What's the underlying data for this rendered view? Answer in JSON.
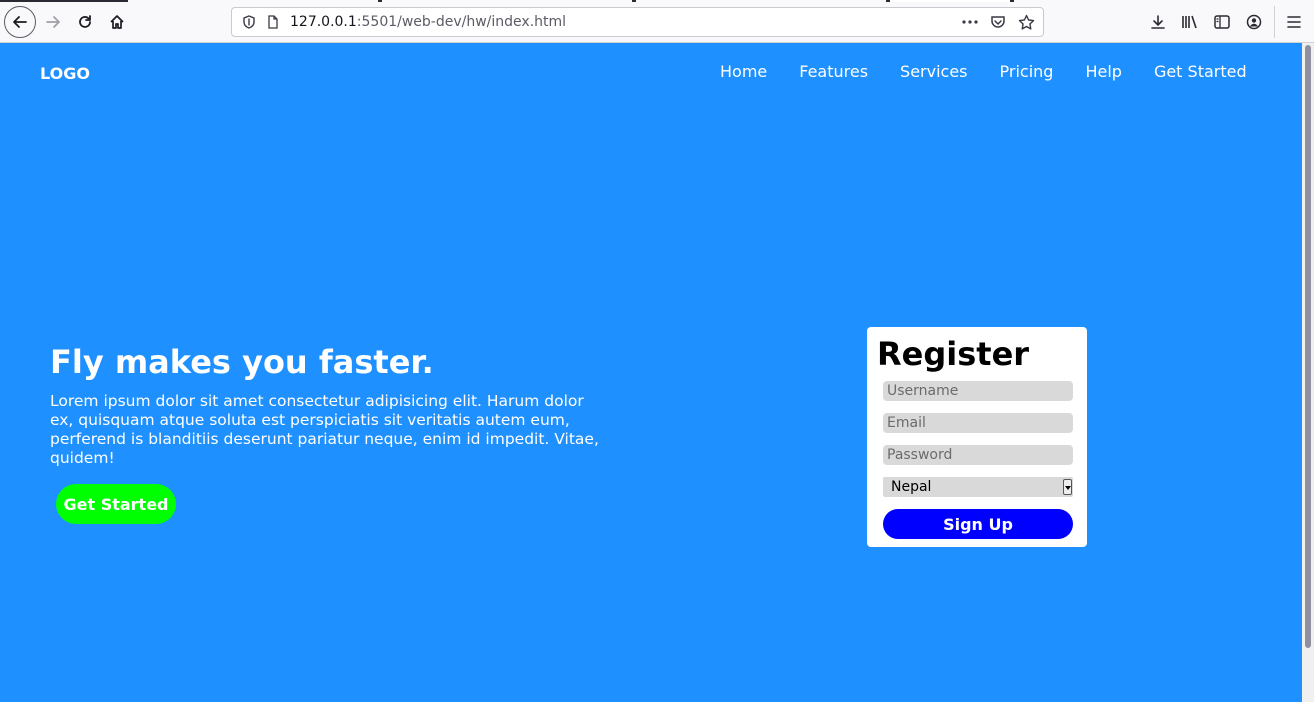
{
  "browser": {
    "url_host": "127.0.0.1",
    "url_rest": ":5501/web-dev/hw/index.html",
    "url_full": "127.0.0.1:5501/web-dev/hw/index.html",
    "icons": [
      "back-icon",
      "forward-icon",
      "reload-icon",
      "home-icon",
      "shield-icon",
      "page-icon",
      "more-icon",
      "pocket-icon",
      "star-icon",
      "download-icon",
      "library-icon",
      "sidebar-icon",
      "account-icon",
      "menu-icon"
    ]
  },
  "nav": {
    "logo": "LOGO",
    "items": [
      "Home",
      "Features",
      "Services",
      "Pricing",
      "Help",
      "Get Started"
    ]
  },
  "hero": {
    "title": "Fly makes you faster.",
    "text": "Lorem ipsum dolor sit amet consectetur adipisicing elit. Harum dolor ex, quisquam atque soluta est perspiciatis sit veritatis autem eum, perferend is blanditiis deserunt pariatur neque, enim id impedit. Vitae, quidem!",
    "button": "Get Started"
  },
  "register": {
    "title": "Register",
    "username_placeholder": "Username",
    "email_placeholder": "Email",
    "password_placeholder": "Password",
    "country_selected": "Nepal",
    "submit": "Sign Up"
  },
  "colors": {
    "background": "#1e90ff",
    "hero_button": "#00ff00",
    "signup_button": "#0000ff"
  }
}
